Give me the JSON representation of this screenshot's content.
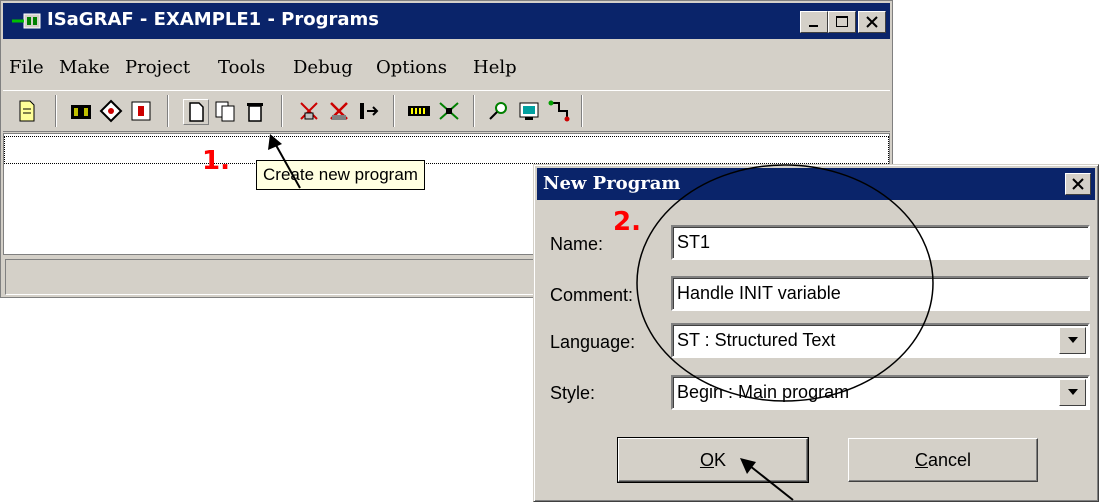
{
  "window": {
    "title": "ISaGRAF - EXAMPLE1 - Programs",
    "controls": [
      "minimize-icon",
      "maximize-icon",
      "close-icon"
    ]
  },
  "menu": {
    "items": [
      {
        "label": "File"
      },
      {
        "label": "Make"
      },
      {
        "label": "Project"
      },
      {
        "label": "Tools"
      },
      {
        "label": "Debug"
      },
      {
        "label": "Options"
      },
      {
        "label": "Help"
      }
    ]
  },
  "toolbar": {
    "icons": [
      "open-document-icon",
      "make-library-icon",
      "link-icon",
      "dictionary-icon",
      "new-program-icon",
      "copy-program-icon",
      "delete-program-icon",
      "compile-icon",
      "cut-icon",
      "move-icon",
      "io-connection-icon",
      "simulate-icon",
      "debug-icon",
      "print-icon",
      "network-icon"
    ]
  },
  "tooltip": {
    "text": "Create new program"
  },
  "steps": {
    "one": "1.",
    "two": "2."
  },
  "dialog": {
    "title": "New Program",
    "name": {
      "label": "Name:",
      "value": "ST1"
    },
    "comment": {
      "label": "Comment:",
      "value": "Handle INIT variable"
    },
    "language": {
      "label": "Language:",
      "value": "ST : Structured Text"
    },
    "style": {
      "label": "Style:",
      "value": "Begin : Main program"
    },
    "ok": {
      "underline": "O",
      "rest": "K"
    },
    "cancel": {
      "underline": "C",
      "rest": "ancel"
    }
  },
  "colors": {
    "titlebar": "#0a246a",
    "face": "#d4d0c8",
    "step": "#ff0000",
    "tooltip": "#ffffe1"
  }
}
